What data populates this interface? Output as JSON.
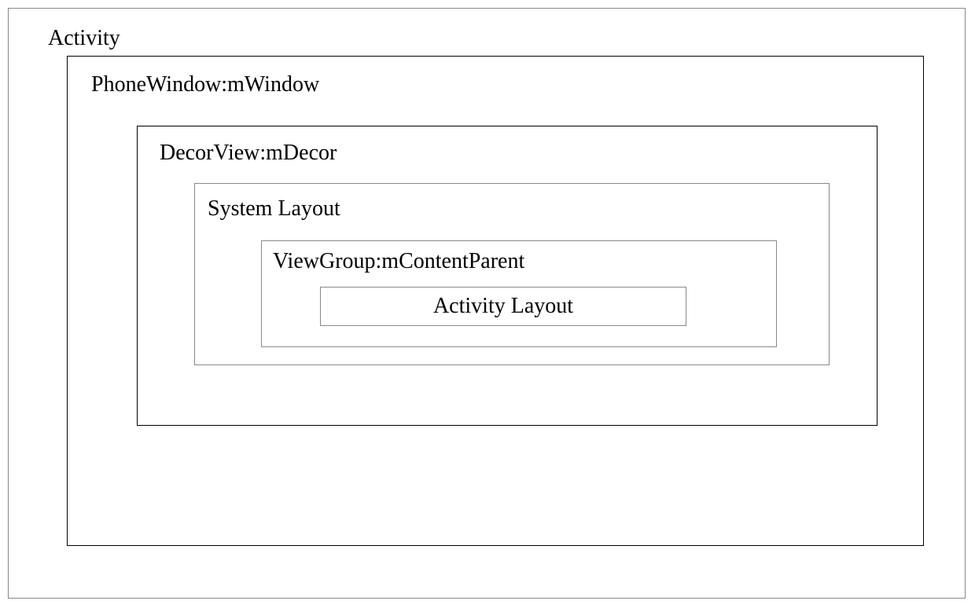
{
  "diagram": {
    "activity": "Activity",
    "phoneWindow": "PhoneWindow:mWindow",
    "decorView": "DecorView:mDecor",
    "systemLayout": "System Layout",
    "viewGroup": "ViewGroup:mContentParent",
    "activityLayout": "Activity Layout"
  }
}
